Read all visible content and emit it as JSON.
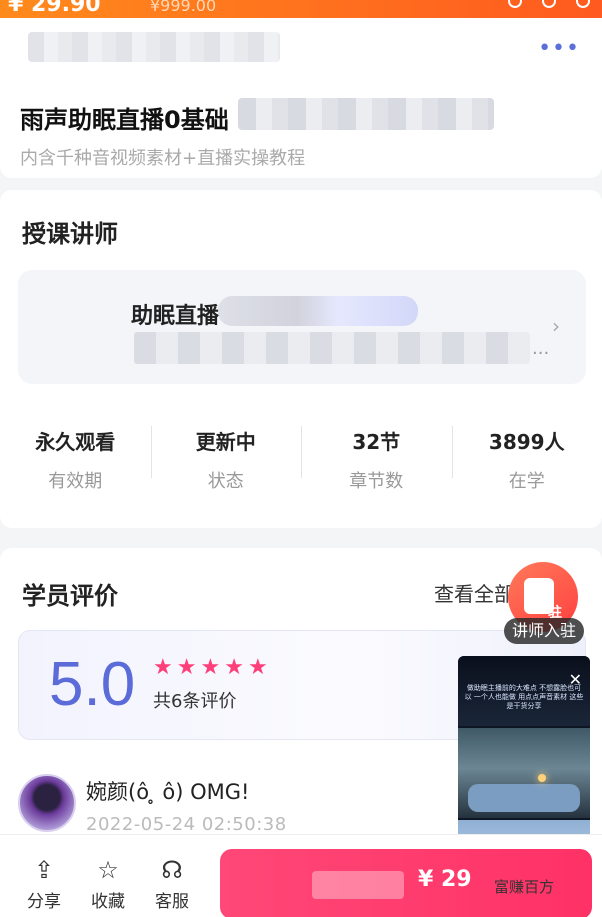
{
  "topbar": {
    "price": "¥ 29.90",
    "original_price": "¥999.00"
  },
  "course": {
    "title": "雨声助眠直播0基础",
    "subtitle": "内含千种音视频素材+直播实操教程"
  },
  "teacher_section": {
    "heading": "授课讲师",
    "teacher_name": "助眠直播",
    "desc_ellipsis": "..."
  },
  "stats": [
    {
      "value": "永久观看",
      "label": "有效期"
    },
    {
      "value": "更新中",
      "label": "状态"
    },
    {
      "value": "32节",
      "label": "章节数"
    },
    {
      "value": "3899人",
      "label": "在学"
    }
  ],
  "reviews": {
    "heading": "学员评价",
    "see_all": "查看全部",
    "score": "5.0",
    "star_count": 5,
    "count_text": "共6条评价",
    "first_review": {
      "name": "婉颜(ô ̥ ô) OMG!",
      "time": "2022-05-24 02:50:38"
    }
  },
  "bottom_bar": {
    "share": "分享",
    "favorite": "收藏",
    "service": "客服",
    "buy_price": "¥ 29"
  },
  "floating": {
    "join_label": "讲师入驻",
    "join_badge": "驻",
    "video_caption": "做助眠主播前的大难点 不想露脸也可以 一个人也能做 用点点声音素材 这些是干货分享"
  },
  "watermark": "富赚百方",
  "colors": {
    "accent": "#ff3f7a",
    "score_blue": "#5b6bd8",
    "orange": "#ff6a1f"
  }
}
